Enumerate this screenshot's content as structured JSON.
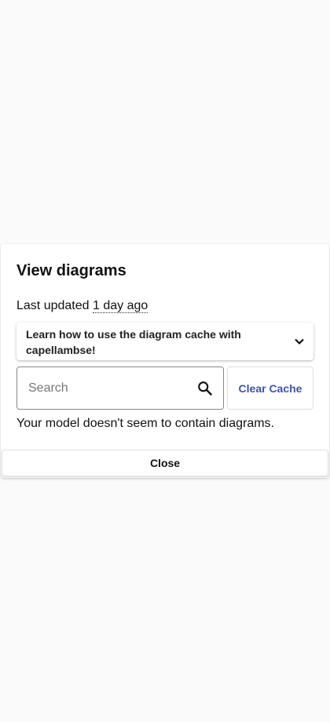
{
  "dialog": {
    "title": "View diagrams",
    "last_updated_label": "Last updated",
    "last_updated_value": "1 day ago",
    "help_panel": {
      "label": "Learn how to use the diagram cache with capellambse!",
      "icon": "chevron-down-icon"
    },
    "search": {
      "placeholder": "Search",
      "value": "",
      "icon": "search-icon"
    },
    "clear_cache_label": "Clear Cache",
    "empty_message": "Your model doesn't seem to contain diagrams.",
    "close_label": "Close"
  },
  "colors": {
    "accent": "#3f51b5",
    "background": "#fafafa"
  }
}
